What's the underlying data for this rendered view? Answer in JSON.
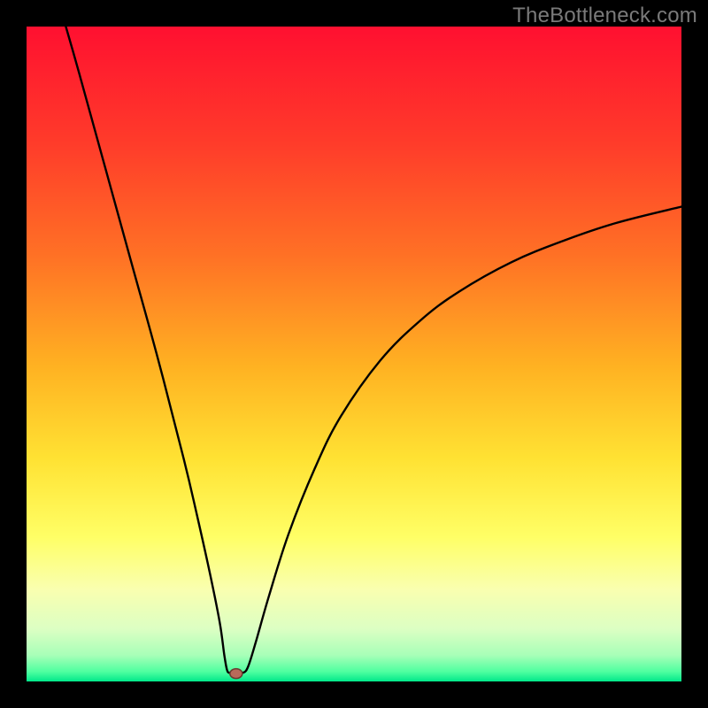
{
  "watermark": {
    "text": "TheBottleneck.com"
  },
  "colors": {
    "frame": "#000000",
    "curve": "#000000",
    "marker_fill": "#b86a5a",
    "marker_stroke": "#6b3a30",
    "gradient_stops": [
      {
        "offset": 0.0,
        "color": "#ff1030"
      },
      {
        "offset": 0.18,
        "color": "#ff3c2a"
      },
      {
        "offset": 0.35,
        "color": "#ff7125"
      },
      {
        "offset": 0.52,
        "color": "#ffb222"
      },
      {
        "offset": 0.66,
        "color": "#ffe233"
      },
      {
        "offset": 0.78,
        "color": "#ffff66"
      },
      {
        "offset": 0.86,
        "color": "#f9ffb0"
      },
      {
        "offset": 0.92,
        "color": "#dcffc3"
      },
      {
        "offset": 0.96,
        "color": "#a8ffb8"
      },
      {
        "offset": 0.985,
        "color": "#4fffa0"
      },
      {
        "offset": 1.0,
        "color": "#00e88a"
      }
    ]
  },
  "chart_data": {
    "type": "line",
    "title": "",
    "xlabel": "",
    "ylabel": "",
    "xlim": [
      0,
      100
    ],
    "ylim": [
      0,
      100
    ],
    "marker": {
      "x": 32.0,
      "y": 1.2
    },
    "series": [
      {
        "name": "bottleneck-curve",
        "points": [
          {
            "x": 6.0,
            "y": 100.0
          },
          {
            "x": 8.0,
            "y": 93.0
          },
          {
            "x": 12.0,
            "y": 78.5
          },
          {
            "x": 16.0,
            "y": 64.0
          },
          {
            "x": 20.0,
            "y": 49.5
          },
          {
            "x": 24.0,
            "y": 34.0
          },
          {
            "x": 26.0,
            "y": 25.5
          },
          {
            "x": 28.0,
            "y": 16.5
          },
          {
            "x": 29.5,
            "y": 9.0
          },
          {
            "x": 30.2,
            "y": 4.0
          },
          {
            "x": 30.6,
            "y": 1.8
          },
          {
            "x": 31.0,
            "y": 1.3
          },
          {
            "x": 32.0,
            "y": 1.2
          },
          {
            "x": 33.0,
            "y": 1.3
          },
          {
            "x": 33.8,
            "y": 2.2
          },
          {
            "x": 35.0,
            "y": 6.0
          },
          {
            "x": 37.0,
            "y": 13.0
          },
          {
            "x": 40.0,
            "y": 22.5
          },
          {
            "x": 44.0,
            "y": 32.5
          },
          {
            "x": 48.0,
            "y": 40.5
          },
          {
            "x": 54.0,
            "y": 49.0
          },
          {
            "x": 60.0,
            "y": 55.0
          },
          {
            "x": 66.0,
            "y": 59.5
          },
          {
            "x": 74.0,
            "y": 64.0
          },
          {
            "x": 82.0,
            "y": 67.3
          },
          {
            "x": 90.0,
            "y": 70.0
          },
          {
            "x": 100.0,
            "y": 72.5
          }
        ]
      }
    ]
  }
}
